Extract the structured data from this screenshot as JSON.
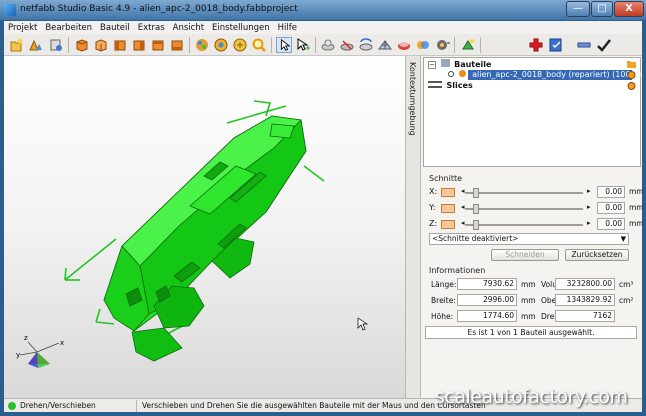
{
  "window": {
    "title": "netfabb Studio Basic 4.9 - alien_apc-2_0018_body.fabbproject",
    "min_glyph": "—",
    "max_glyph": "□",
    "close_glyph": "X"
  },
  "menu": [
    "Projekt",
    "Bearbeiten",
    "Bauteil",
    "Extras",
    "Ansicht",
    "Einstellungen",
    "Hilfe"
  ],
  "toolbar_icons": [
    "new-project-icon",
    "open-project-icon",
    "save-project-icon",
    "view-front-icon",
    "view-back-icon",
    "view-left-icon",
    "view-right-icon",
    "view-top-icon",
    "view-bottom-icon",
    "color-view-icon",
    "shaded-view-icon",
    "zoom-fit-icon",
    "zoom-icon",
    "select-pointer-icon",
    "select-pointer-plus-icon",
    "measure-icon",
    "section-icon",
    "rotate-icon",
    "mesh-icon",
    "material-icon",
    "toggle-icon",
    "settings-icon",
    "light-icon",
    "add-icon",
    "checklist-icon",
    "remove-icon",
    "confirm-icon"
  ],
  "side_tab": "Kontextumgebung",
  "tree": {
    "root": "Bauteile",
    "part": "alien_apc-2_0018_body (repariert) (100%)",
    "slices": "Slices"
  },
  "schnitte": {
    "title": "Schnitte",
    "axes": [
      {
        "label": "X:",
        "value": "0.00",
        "unit": "mm"
      },
      {
        "label": "Y:",
        "value": "0.00",
        "unit": "mm"
      },
      {
        "label": "Z:",
        "value": "0.00",
        "unit": "mm"
      }
    ],
    "left_arrow": "◂",
    "right_arrow": "▸",
    "dropdown_value": "<Schnitte deaktiviert>",
    "cut_button": "Schneiden",
    "reset_button": "Zurücksetzen"
  },
  "info": {
    "title": "Informationen",
    "length_label": "Länge:",
    "length_value": "7930.62",
    "length_unit": "mm",
    "width_label": "Breite:",
    "width_value": "2996.00",
    "width_unit": "mm",
    "height_label": "Höhe:",
    "height_value": "1774.60",
    "height_unit": "mm",
    "volume_label": "Volumen:",
    "volume_value": "3232800.00",
    "volume_unit": "cm³",
    "surface_label": "Oberfläche:",
    "surface_value": "1343829.92",
    "surface_unit": "cm²",
    "triangles_label": "Dreiecke:",
    "triangles_value": "7162",
    "selection_status": "Es ist 1 von 1 Bauteil ausgewählt."
  },
  "axes_gizmo": {
    "x": "x",
    "y": "y",
    "z": "z"
  },
  "status": {
    "mode": "Drehen/Verschieben",
    "hint": "Verschieben und Drehen Sie die ausgewählten Bauteile mit der Maus und den Cursortasten"
  },
  "watermark": "scaleautofactory.com",
  "colors": {
    "model": "#19d419",
    "accent": "#3468b5",
    "guide": "#1fc61f"
  }
}
